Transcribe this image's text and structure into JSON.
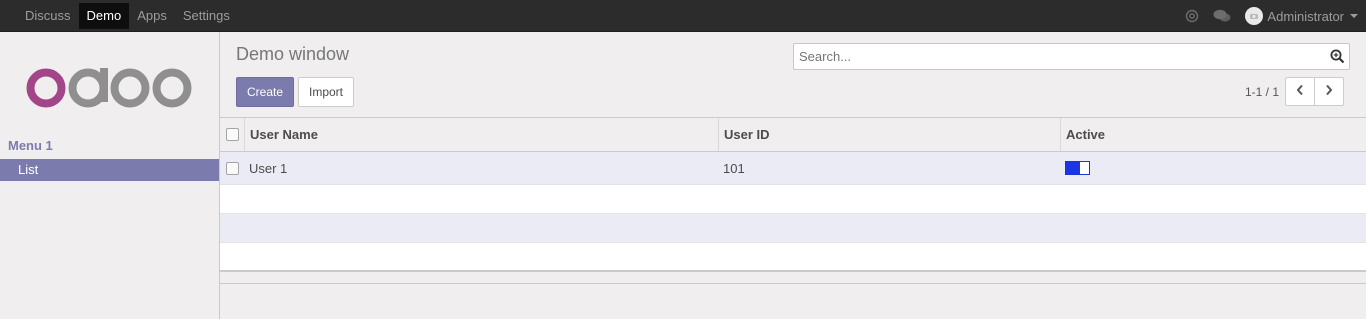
{
  "topbar": {
    "apps": [
      "Discuss",
      "Demo",
      "Apps",
      "Settings"
    ],
    "active_app": "Demo",
    "mention_icon": "at-icon",
    "chat_icon": "chat-bubbles-icon",
    "user_name": "Administrator"
  },
  "sidebar": {
    "logo_text": "odoo",
    "menu_title": "Menu 1",
    "items": [
      {
        "label": "List",
        "active": true
      }
    ]
  },
  "control_panel": {
    "title": "Demo window",
    "create_label": "Create",
    "import_label": "Import",
    "search_placeholder": "Search...",
    "search_value": "",
    "pager_value": "1-1 / 1"
  },
  "table": {
    "columns": [
      "User Name",
      "User ID",
      "Active"
    ],
    "rows": [
      {
        "user_name": "User 1",
        "user_id": "101",
        "active": true
      }
    ]
  },
  "colors": {
    "brand": "#7c7bad",
    "topbar": "#2c2c2c",
    "toggle_on": "#1a35e6"
  }
}
